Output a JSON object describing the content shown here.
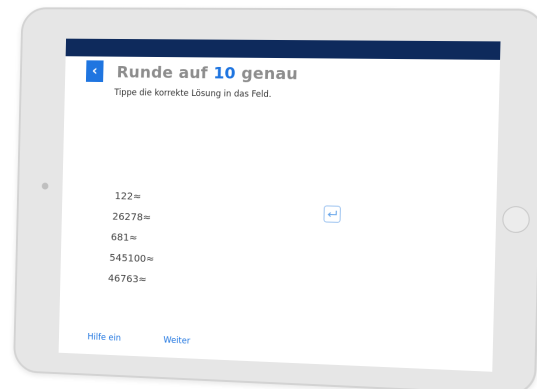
{
  "header": {
    "title_prefix": "Runde auf ",
    "title_number": "10",
    "title_suffix": " genau",
    "back_icon": "chevron-left-icon"
  },
  "instruction": "Tippe die korrekte Lösung in das Feld.",
  "problems": [
    {
      "label": "122≈"
    },
    {
      "label": "26278≈"
    },
    {
      "label": "681≈"
    },
    {
      "label": "545100≈"
    },
    {
      "label": "46763≈"
    }
  ],
  "enter_icon": "enter-return-icon",
  "footer": {
    "hint_label": "Hilfe ein",
    "next_label": "Weiter"
  },
  "colors": {
    "topbar": "#0e2a5c",
    "accent": "#1f75e0",
    "title_gray": "#8d8d8d"
  }
}
